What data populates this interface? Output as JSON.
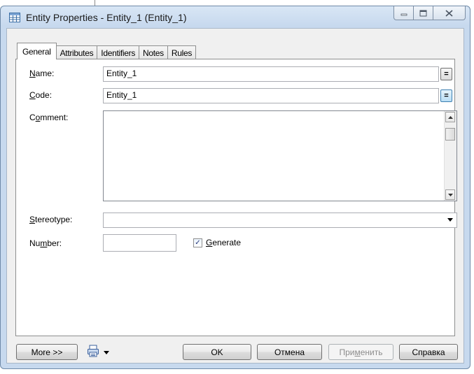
{
  "window": {
    "title": "Entity Properties - Entity_1 (Entity_1)",
    "icon": "table-icon"
  },
  "tabs": [
    {
      "label": "General",
      "active": true
    },
    {
      "label": "Attributes",
      "active": false
    },
    {
      "label": "Identifiers",
      "active": false
    },
    {
      "label": "Notes",
      "active": false
    },
    {
      "label": "Rules",
      "active": false
    }
  ],
  "form": {
    "name": {
      "mnemonic": "N",
      "rest": "ame:",
      "value": "Entity_1",
      "button": "="
    },
    "code": {
      "mnemonic": "C",
      "rest": "ode:",
      "value": "Entity_1",
      "button": "="
    },
    "comment": {
      "prefix": "C",
      "mnemonic": "o",
      "rest": "mment:",
      "value": ""
    },
    "stereotype": {
      "mnemonic": "S",
      "rest": "tereotype:",
      "value": ""
    },
    "number": {
      "prefix": "Nu",
      "mnemonic": "m",
      "rest": "ber:",
      "value": ""
    },
    "generate": {
      "mnemonic": "G",
      "rest": "enerate",
      "checked": true,
      "check_glyph": "✓"
    }
  },
  "buttons": {
    "more": "More >>",
    "ok": "OK",
    "cancel": "Отмена",
    "apply_prefix": "При",
    "apply_mnemonic": "м",
    "apply_rest": "енить",
    "help": "Справка"
  },
  "colors": {
    "title_bg": "#c7d9ee",
    "active_eq_button": "#b9def5",
    "check_mark": "#26367a"
  }
}
